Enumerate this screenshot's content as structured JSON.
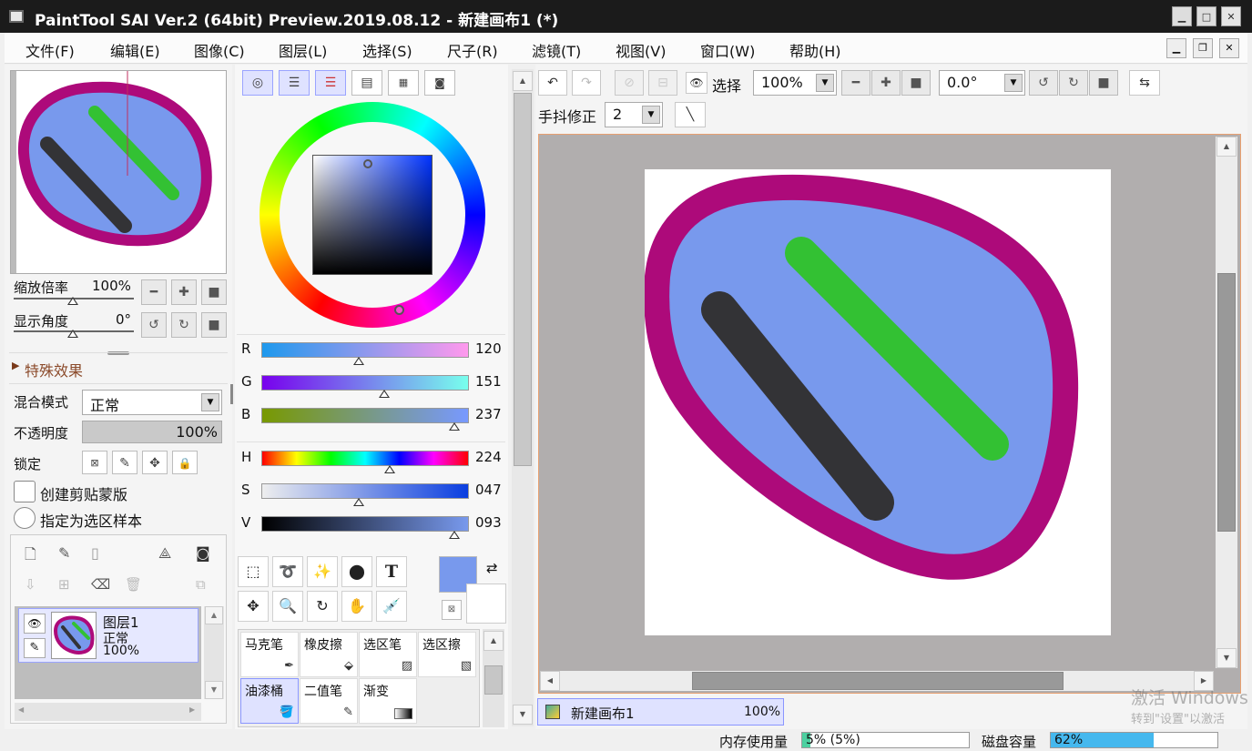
{
  "window": {
    "title": "PaintTool SAI Ver.2 (64bit) Preview.2019.08.12 - 新建画布1 (*)"
  },
  "menu": [
    "文件(F)",
    "编辑(E)",
    "图像(C)",
    "图层(L)",
    "选择(S)",
    "尺子(R)",
    "滤镜(T)",
    "视图(V)",
    "窗口(W)",
    "帮助(H)"
  ],
  "navigator": {
    "zoom_label": "缩放倍率",
    "zoom_value": "100%",
    "angle_label": "显示角度",
    "angle_value": "0°"
  },
  "effects": {
    "header": "特殊效果"
  },
  "layer_props": {
    "blend_label": "混合模式",
    "blend_value": "正常",
    "opacity_label": "不透明度",
    "opacity_value": "100%",
    "opacity_fraction": 1.0,
    "lock_label": "锁定",
    "clip_label": "创建剪贴蒙版",
    "select_src_label": "指定为选区样本"
  },
  "layers": [
    {
      "name": "图层1",
      "mode": "正常",
      "opacity": "100%"
    }
  ],
  "color": {
    "current": "#7899ed",
    "sliders": [
      {
        "label": "R",
        "value": "120",
        "level": 0.47
      },
      {
        "label": "G",
        "value": "151",
        "level": 0.59
      },
      {
        "label": "B",
        "value": "237",
        "level": 0.93
      },
      {
        "label": "H",
        "value": "224",
        "level": 0.62
      },
      {
        "label": "S",
        "value": "047",
        "level": 0.47
      },
      {
        "label": "V",
        "value": "093",
        "level": 0.93
      }
    ]
  },
  "brushes": [
    {
      "label": "马克笔",
      "icon": "pen-icon"
    },
    {
      "label": "橡皮擦",
      "icon": "eraser-icon"
    },
    {
      "label": "选区笔",
      "icon": "selpen-icon"
    },
    {
      "label": "选区擦",
      "icon": "selerase-icon"
    },
    {
      "label": "油漆桶",
      "icon": "bucket-icon"
    },
    {
      "label": "二值笔",
      "icon": "binary-pen-icon"
    },
    {
      "label": "渐变",
      "icon": "gradient-icon"
    }
  ],
  "toolbar": {
    "select_label": "选择",
    "zoom_value": "100%",
    "angle_value": "0.0°",
    "stabilizer_label": "手抖修正",
    "stabilizer_value": "2"
  },
  "canvas_tab": {
    "name": "新建画布1",
    "zoom": "100%"
  },
  "status": {
    "mem_label": "内存使用量",
    "mem_value": "5% (5%)",
    "mem_fraction": 0.05,
    "disk_label": "磁盘容量",
    "disk_value": "62%",
    "disk_fraction": 0.62
  },
  "watermark": {
    "line1": "激活 Windows",
    "line2": "转到\"设置\"以激活"
  },
  "colors": {
    "border": "#ad0a7a",
    "fill": "#7899ed",
    "green": "#33c133",
    "dark": "#333336"
  }
}
